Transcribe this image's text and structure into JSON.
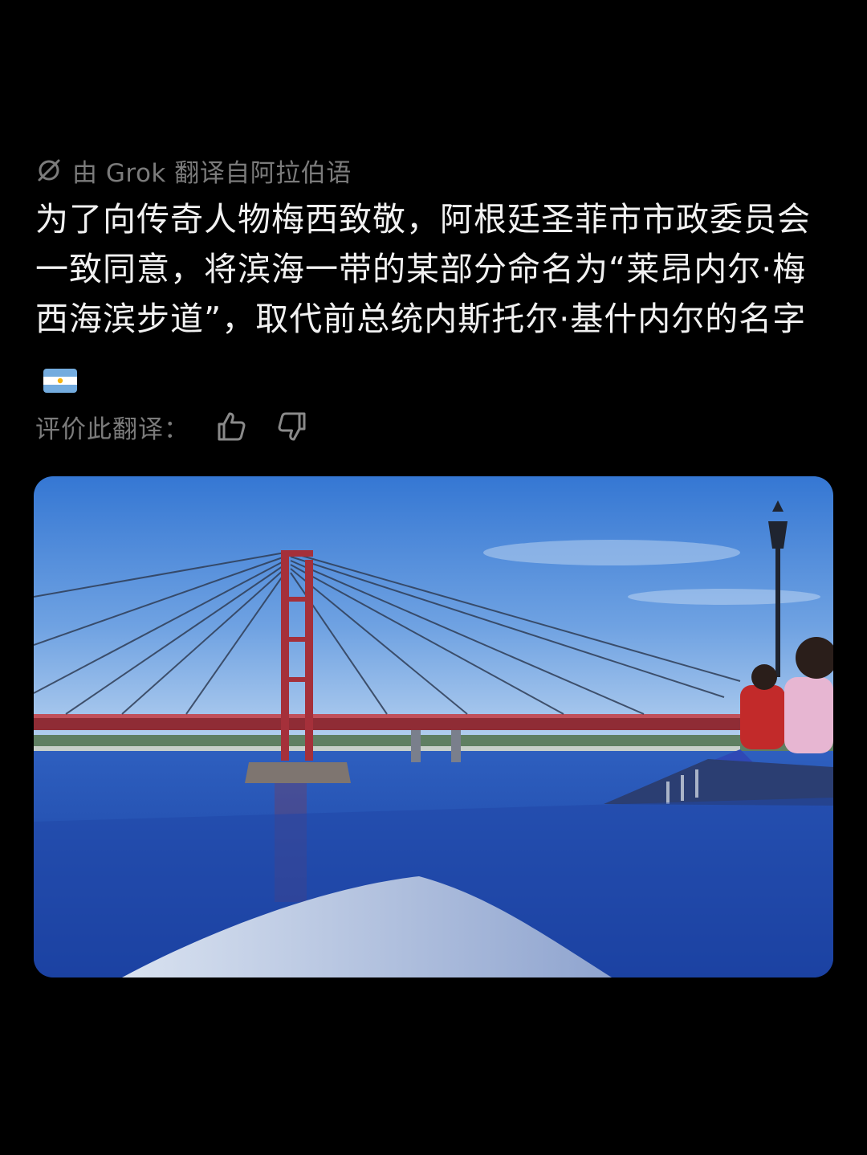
{
  "translation_badge": {
    "icon": "grok-icon",
    "text": "由 Grok 翻译自阿拉伯语"
  },
  "post": {
    "text": "为了向传奇人物梅西致敬，阿根廷圣菲市市政委员会一致同意，将滨海一带的某部分命名为“莱昂内尔·梅西海滨步道”，取代前总统内斯托尔·基什内尔的名字",
    "emoji": "argentina-flag-icon"
  },
  "rating": {
    "label": "评价此翻译：",
    "thumbs_up_icon": "thumbs-up-icon",
    "thumbs_down_icon": "thumbs-down-icon"
  },
  "media": {
    "image": "photo-red-suspension-bridge-over-blue-river",
    "colors": {
      "sky": "#3f7fd6",
      "water": "#2a5bc4",
      "bridge": "#a5303a"
    }
  }
}
